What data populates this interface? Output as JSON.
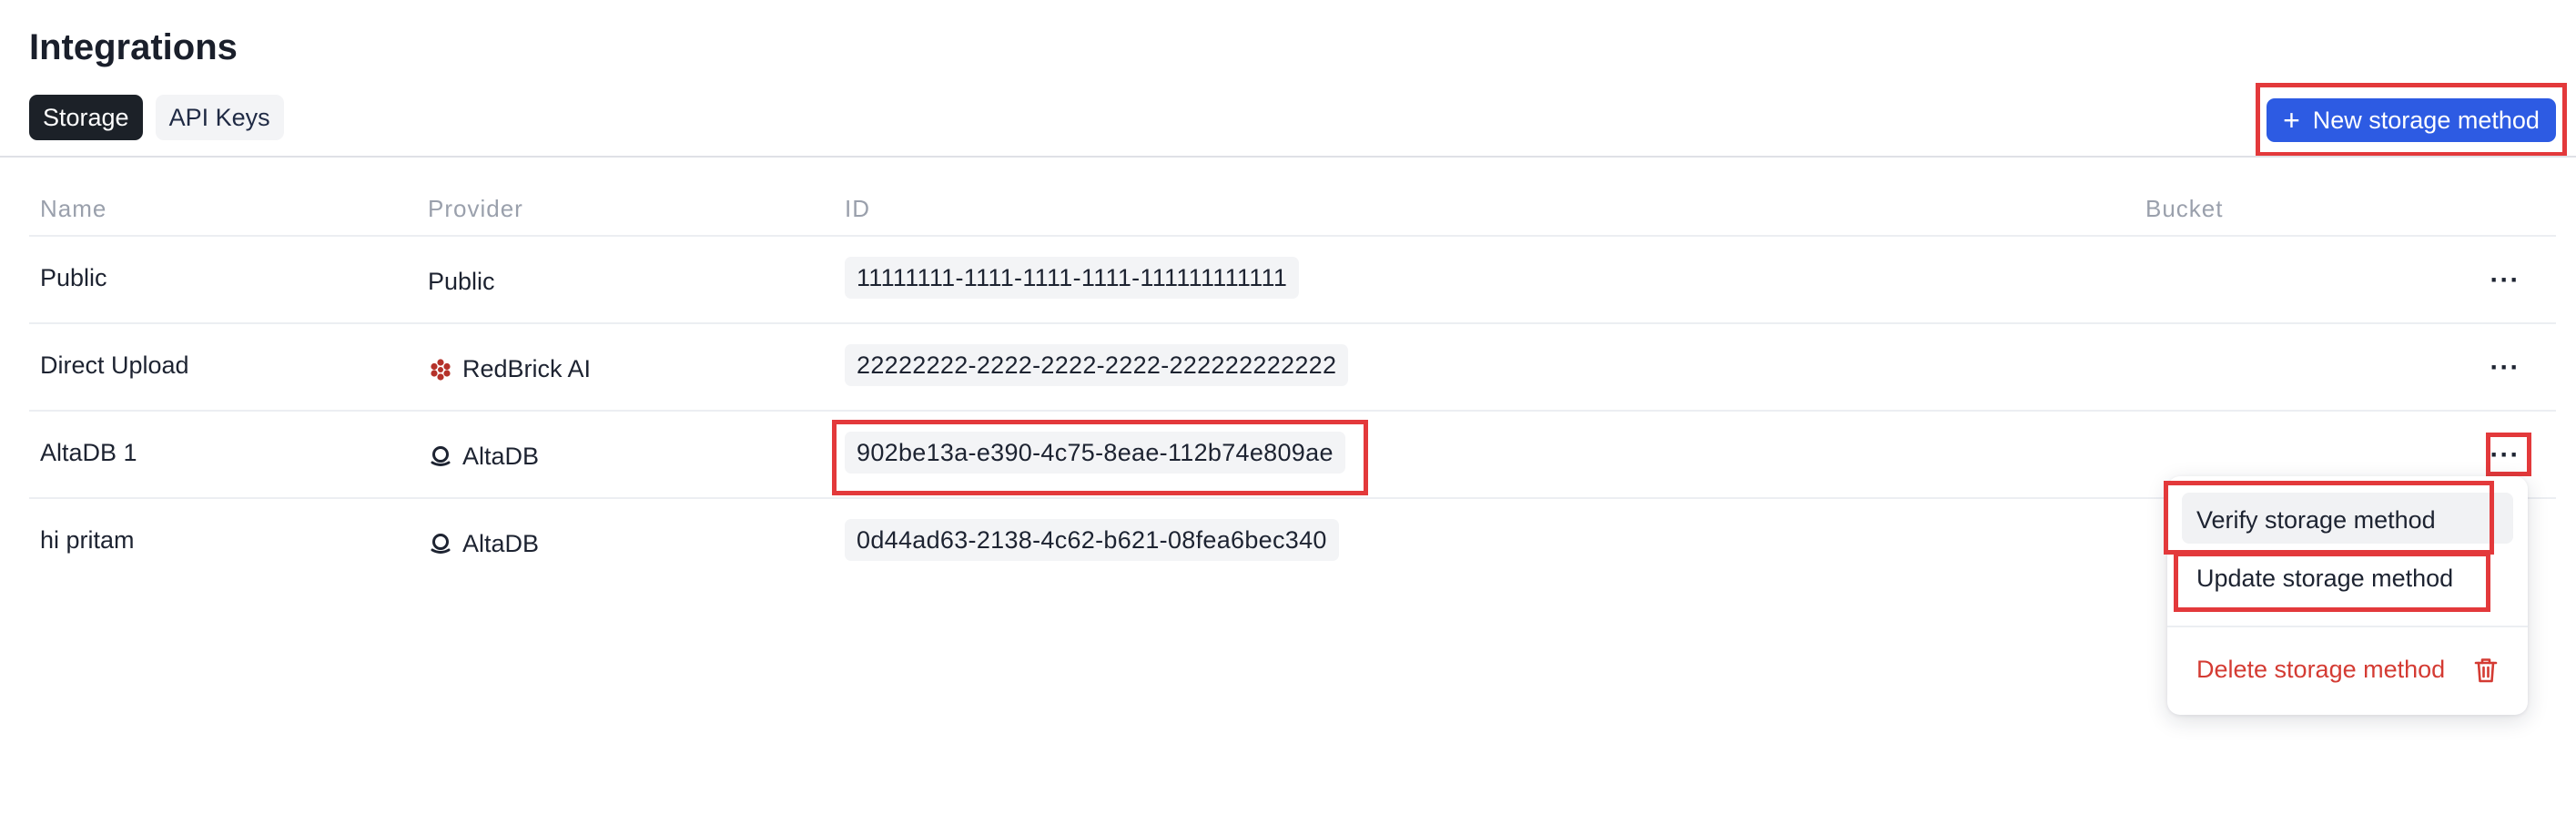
{
  "page": {
    "title": "Integrations"
  },
  "tabs": [
    {
      "label": "Storage",
      "active": true
    },
    {
      "label": "API Keys",
      "active": false
    }
  ],
  "actions": {
    "new_storage_label": "New storage method",
    "new_storage_icon": "plus-icon"
  },
  "table": {
    "columns": [
      "Name",
      "Provider",
      "ID",
      "Bucket"
    ],
    "rows": [
      {
        "name": "Public",
        "provider": "Public",
        "provider_icon": null,
        "id": "11111111-1111-1111-1111-111111111111",
        "bucket": ""
      },
      {
        "name": "Direct Upload",
        "provider": "RedBrick AI",
        "provider_icon": "redbrick-logo-icon",
        "id": "22222222-2222-2222-2222-222222222222",
        "bucket": ""
      },
      {
        "name": "AltaDB 1",
        "provider": "AltaDB",
        "provider_icon": "altadb-logo-icon",
        "id": "902be13a-e390-4c75-8eae-112b74e809ae",
        "bucket": ""
      },
      {
        "name": "hi pritam",
        "provider": "AltaDB",
        "provider_icon": "altadb-logo-icon",
        "id": "0d44ad63-2138-4c62-b621-08fea6bec340",
        "bucket": ""
      }
    ],
    "row_menu_icon": "more-horizontal-icon"
  },
  "context_menu": {
    "items": [
      {
        "label": "Verify storage method"
      },
      {
        "label": "Update storage method"
      },
      {
        "label": "Delete storage method",
        "danger": true,
        "icon": "trash-icon"
      }
    ]
  },
  "colors": {
    "accent": "#2d5be3",
    "active_tab": "#1c2128",
    "danger": "#d43b33",
    "highlight": "#e3393b",
    "redbrick": "#b5322a"
  }
}
